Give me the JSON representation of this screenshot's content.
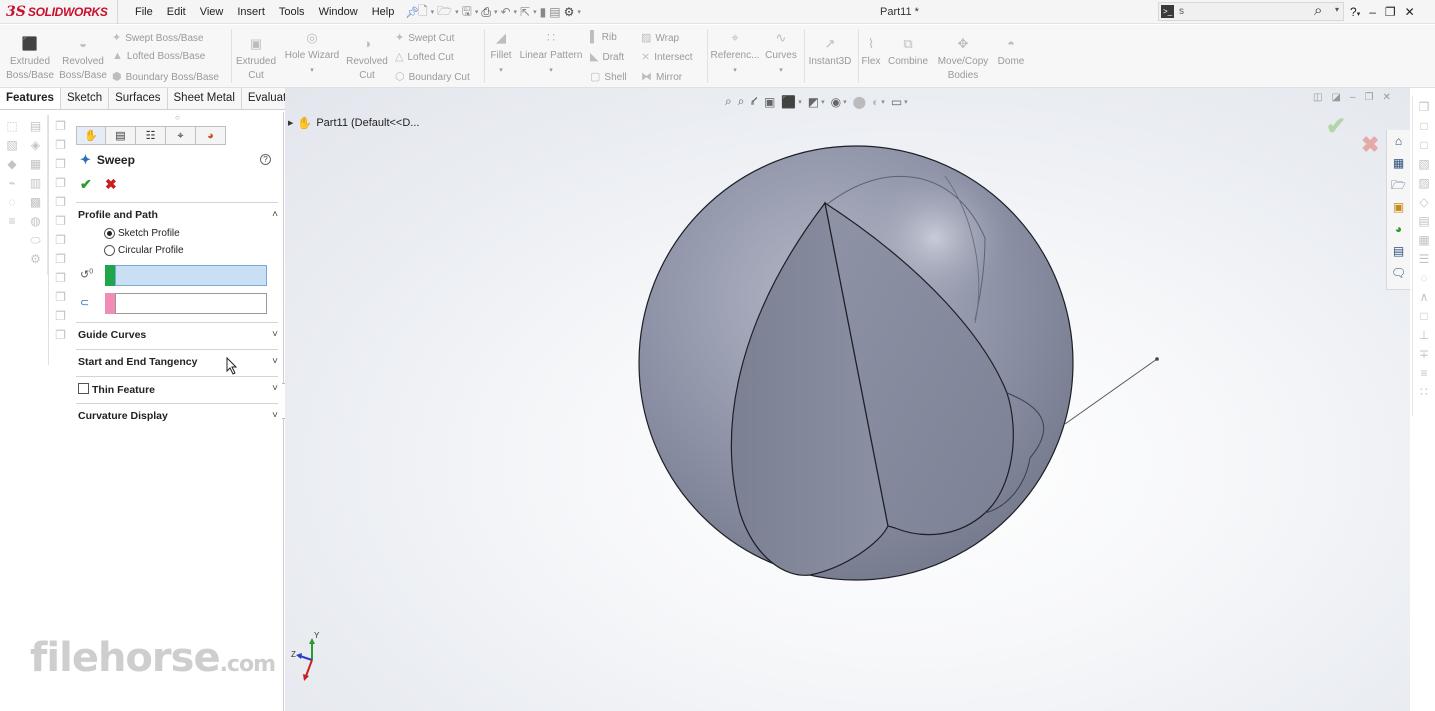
{
  "app": {
    "logo_ds": "3S",
    "logo_text": "SOLIDWORKS",
    "document_title": "Part11 *"
  },
  "menu": [
    "File",
    "Edit",
    "View",
    "Insert",
    "Tools",
    "Window",
    "Help"
  ],
  "search": {
    "value": "s"
  },
  "ribbon": {
    "extruded_boss": [
      "Extruded",
      "Boss/Base"
    ],
    "revolved_boss": [
      "Revolved",
      "Boss/Base"
    ],
    "swept_boss": "Swept Boss/Base",
    "lofted_boss": "Lofted Boss/Base",
    "boundary_boss": "Boundary Boss/Base",
    "extruded_cut": [
      "Extruded",
      "Cut"
    ],
    "hole_wizard": "Hole Wizard",
    "revolved_cut": [
      "Revolved",
      "Cut"
    ],
    "swept_cut": "Swept Cut",
    "lofted_cut": "Lofted Cut",
    "boundary_cut": "Boundary Cut",
    "fillet": "Fillet",
    "linear_pattern": "Linear Pattern",
    "rib": "Rib",
    "draft": "Draft",
    "shell": "Shell",
    "wrap": "Wrap",
    "intersect": "Intersect",
    "mirror": "Mirror",
    "reference": "Referenc...",
    "curves": "Curves",
    "instant3d": "Instant3D",
    "flex": "Flex",
    "combine": "Combine",
    "move_copy": [
      "Move/Copy",
      "Bodies"
    ],
    "dome": "Dome"
  },
  "tabs": [
    "Features",
    "Sketch",
    "Surfaces",
    "Sheet Metal",
    "Evaluate"
  ],
  "property_manager": {
    "title": "Sweep",
    "help": "?",
    "profile_path": {
      "header": "Profile and Path",
      "option_sketch": "Sketch Profile",
      "option_circular": "Circular Profile",
      "selected_option": "Sketch Profile",
      "profile_color": "#1fa64a",
      "path_color": "#f08cb6"
    },
    "guide_curves": "Guide Curves",
    "tangency": "Start and End Tangency",
    "thin_feature": "Thin Feature",
    "curvature_display": "Curvature Display"
  },
  "feature_tree": {
    "item": "Part11  (Default<<D..."
  },
  "colors": {
    "accent": "#2f6fb8",
    "ok": "#2e9a2e",
    "cancel": "#c81e1e",
    "solid_body": "#8a8fa2"
  },
  "watermark": {
    "main": "filehorse",
    "suffix": ".com"
  },
  "triad": {
    "x": "Z",
    "y": "Y"
  }
}
